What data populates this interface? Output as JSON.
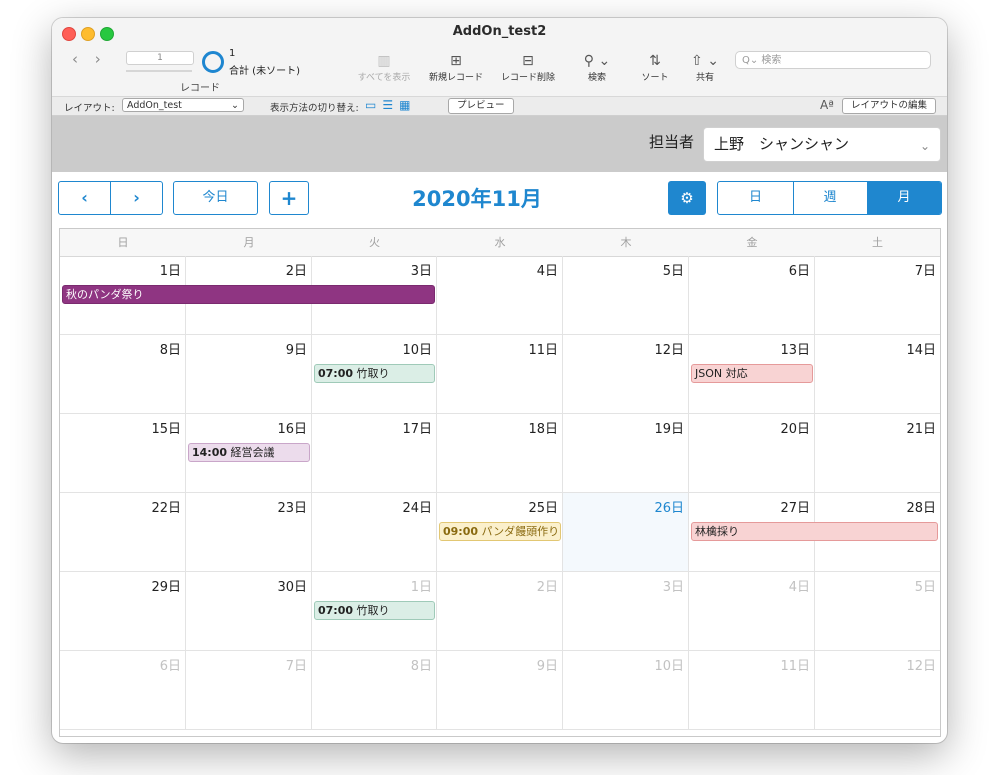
{
  "window": {
    "title": "AddOn_test2"
  },
  "toolbar": {
    "nav_arrows": "‹ ›",
    "record_field_value": "1",
    "record_label": "レコード",
    "record_count": "1",
    "record_total": "合計 (未ソート)",
    "show_all": "すべてを表示",
    "new_record": "新規レコード",
    "delete_record": "レコード削除",
    "find": "検索",
    "sort": "ソート",
    "share": "共有",
    "search_placeholder": "Q⌄ 検索"
  },
  "layoutbar": {
    "layout_label": "レイアウト:",
    "layout_value": "AddOn_test",
    "view_label": "表示方法の切り替え:",
    "preview": "プレビュー",
    "aa": "Aª",
    "edit_layout": "レイアウトの編集"
  },
  "header": {
    "assignee_label": "担当者",
    "assignee_value": "上野　シャンシャン"
  },
  "calendar": {
    "prev": "‹",
    "next": "›",
    "today": "今日",
    "add": "+",
    "month_title": "2020年11月",
    "view_day": "日",
    "view_week": "週",
    "view_month": "月",
    "weekdays": [
      "日",
      "月",
      "火",
      "水",
      "木",
      "金",
      "土"
    ],
    "weeks": [
      [
        "1日",
        "2日",
        "3日",
        "4日",
        "5日",
        "6日",
        "7日"
      ],
      [
        "8日",
        "9日",
        "10日",
        "11日",
        "12日",
        "13日",
        "14日"
      ],
      [
        "15日",
        "16日",
        "17日",
        "18日",
        "19日",
        "20日",
        "21日"
      ],
      [
        "22日",
        "23日",
        "24日",
        "25日",
        "26日",
        "27日",
        "28日"
      ],
      [
        "29日",
        "30日",
        "1日",
        "2日",
        "3日",
        "4日",
        "5日"
      ],
      [
        "6日",
        "7日",
        "8日",
        "9日",
        "10日",
        "11日",
        "12日"
      ]
    ],
    "other_month_cells": [
      [
        4,
        2
      ],
      [
        4,
        3
      ],
      [
        4,
        4
      ],
      [
        4,
        5
      ],
      [
        4,
        6
      ],
      [
        5,
        0
      ],
      [
        5,
        1
      ],
      [
        5,
        2
      ],
      [
        5,
        3
      ],
      [
        5,
        4
      ],
      [
        5,
        5
      ],
      [
        5,
        6
      ]
    ],
    "today_cell": [
      3,
      4
    ],
    "events": [
      {
        "week": 0,
        "day": 0,
        "span": 3,
        "time": "",
        "title": "秋のパンダ祭り",
        "bg": "#8f3582",
        "border": "#7a2a6f",
        "color": "#ffffff"
      },
      {
        "week": 1,
        "day": 2,
        "span": 1,
        "time": "07:00",
        "title": "竹取り",
        "bg": "#dbeee6",
        "border": "#9fcab8",
        "color": "#222222"
      },
      {
        "week": 1,
        "day": 5,
        "span": 1,
        "time": "",
        "title": "JSON 対応",
        "bg": "#f8d3d3",
        "border": "#e59a9a",
        "color": "#222222"
      },
      {
        "week": 2,
        "day": 1,
        "span": 1,
        "time": "14:00",
        "title": "経営会議",
        "bg": "#ecdcec",
        "border": "#c9a6c9",
        "color": "#222222"
      },
      {
        "week": 3,
        "day": 3,
        "span": 1,
        "time": "09:00",
        "title": "パンダ饅頭作り",
        "bg": "#fbf0cc",
        "border": "#e2c773",
        "color": "#8a6a10"
      },
      {
        "week": 3,
        "day": 5,
        "span": 2,
        "time": "",
        "title": "林檎採り",
        "bg": "#f8d3d3",
        "border": "#e59a9a",
        "color": "#222222"
      },
      {
        "week": 4,
        "day": 2,
        "span": 1,
        "time": "07:00",
        "title": "竹取り",
        "bg": "#dbeee6",
        "border": "#9fcab8",
        "color": "#222222"
      }
    ]
  }
}
